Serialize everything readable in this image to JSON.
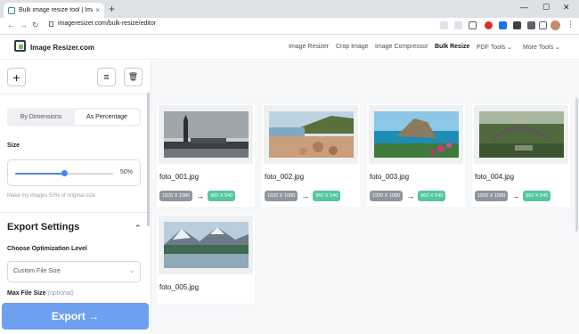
{
  "browser": {
    "tab_title": "Bulk image resize tool | ImageResizer",
    "tab_close": "×",
    "new_tab": "+",
    "url": "imageresizer.com/bulk-resize/editor",
    "nav_back": "←",
    "nav_forward": "→",
    "nav_reload": "↻",
    "window_min": "—",
    "window_max": "☐",
    "window_close": "✕",
    "menu_dots": "⋮"
  },
  "site": {
    "logo_text": "Image Resizer.com",
    "nav": [
      {
        "label": "Image Resizer"
      },
      {
        "label": "Crop Image"
      },
      {
        "label": "Image Compressor"
      },
      {
        "label": "Bulk Resize"
      },
      {
        "label": "PDF Tools ⌄"
      },
      {
        "label": "More Tools ⌄"
      }
    ]
  },
  "sidebar": {
    "add_icon": "+",
    "filter_icon": "≡",
    "delete_icon": "🗑",
    "segment": {
      "by_dimensions": "By Dimensions",
      "as_percentage": "As Percentage"
    },
    "size_label": "Size",
    "size_value": "50%",
    "size_fraction": 0.5,
    "size_hint": "Make my images 50% of original size",
    "export_settings": "Export Settings",
    "collapse_icon": "⌃",
    "opt_level_label": "Choose Optimization Level",
    "opt_level_value": "Custom File Size",
    "select_chevron": "⌄",
    "max_size_label": "Max File Size",
    "max_size_optional": "(optional)",
    "export_button": "Export →"
  },
  "images": [
    {
      "name": "foto_001.jpg",
      "from": "1920 X 1080",
      "to": "960 X 540",
      "arrow": "→"
    },
    {
      "name": "foto_002.jpg",
      "from": "1920 X 1080",
      "to": "960 X 540",
      "arrow": "→"
    },
    {
      "name": "foto_003.jpg",
      "from": "1920 X 1080",
      "to": "960 X 540",
      "arrow": "→"
    },
    {
      "name": "foto_004.jpg",
      "from": "1920 X 1080",
      "to": "960 X 540",
      "arrow": "→"
    },
    {
      "name": "foto_005.jpg"
    }
  ],
  "colors": {
    "accent": "#4a86f0",
    "export": "#6fa0ef",
    "pill_from": "#8f969d",
    "pill_to": "#54c7a0"
  }
}
